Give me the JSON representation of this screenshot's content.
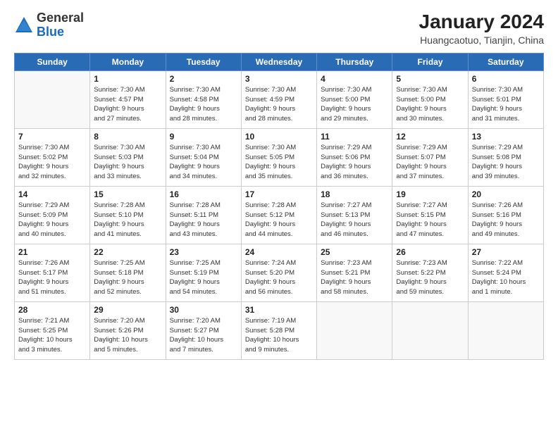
{
  "logo": {
    "general": "General",
    "blue": "Blue"
  },
  "title": "January 2024",
  "location": "Huangcaotuo, Tianjin, China",
  "weekdays": [
    "Sunday",
    "Monday",
    "Tuesday",
    "Wednesday",
    "Thursday",
    "Friday",
    "Saturday"
  ],
  "weeks": [
    [
      {
        "day": "",
        "info": ""
      },
      {
        "day": "1",
        "info": "Sunrise: 7:30 AM\nSunset: 4:57 PM\nDaylight: 9 hours\nand 27 minutes."
      },
      {
        "day": "2",
        "info": "Sunrise: 7:30 AM\nSunset: 4:58 PM\nDaylight: 9 hours\nand 28 minutes."
      },
      {
        "day": "3",
        "info": "Sunrise: 7:30 AM\nSunset: 4:59 PM\nDaylight: 9 hours\nand 28 minutes."
      },
      {
        "day": "4",
        "info": "Sunrise: 7:30 AM\nSunset: 5:00 PM\nDaylight: 9 hours\nand 29 minutes."
      },
      {
        "day": "5",
        "info": "Sunrise: 7:30 AM\nSunset: 5:00 PM\nDaylight: 9 hours\nand 30 minutes."
      },
      {
        "day": "6",
        "info": "Sunrise: 7:30 AM\nSunset: 5:01 PM\nDaylight: 9 hours\nand 31 minutes."
      }
    ],
    [
      {
        "day": "7",
        "info": "Sunrise: 7:30 AM\nSunset: 5:02 PM\nDaylight: 9 hours\nand 32 minutes."
      },
      {
        "day": "8",
        "info": "Sunrise: 7:30 AM\nSunset: 5:03 PM\nDaylight: 9 hours\nand 33 minutes."
      },
      {
        "day": "9",
        "info": "Sunrise: 7:30 AM\nSunset: 5:04 PM\nDaylight: 9 hours\nand 34 minutes."
      },
      {
        "day": "10",
        "info": "Sunrise: 7:30 AM\nSunset: 5:05 PM\nDaylight: 9 hours\nand 35 minutes."
      },
      {
        "day": "11",
        "info": "Sunrise: 7:29 AM\nSunset: 5:06 PM\nDaylight: 9 hours\nand 36 minutes."
      },
      {
        "day": "12",
        "info": "Sunrise: 7:29 AM\nSunset: 5:07 PM\nDaylight: 9 hours\nand 37 minutes."
      },
      {
        "day": "13",
        "info": "Sunrise: 7:29 AM\nSunset: 5:08 PM\nDaylight: 9 hours\nand 39 minutes."
      }
    ],
    [
      {
        "day": "14",
        "info": "Sunrise: 7:29 AM\nSunset: 5:09 PM\nDaylight: 9 hours\nand 40 minutes."
      },
      {
        "day": "15",
        "info": "Sunrise: 7:28 AM\nSunset: 5:10 PM\nDaylight: 9 hours\nand 41 minutes."
      },
      {
        "day": "16",
        "info": "Sunrise: 7:28 AM\nSunset: 5:11 PM\nDaylight: 9 hours\nand 43 minutes."
      },
      {
        "day": "17",
        "info": "Sunrise: 7:28 AM\nSunset: 5:12 PM\nDaylight: 9 hours\nand 44 minutes."
      },
      {
        "day": "18",
        "info": "Sunrise: 7:27 AM\nSunset: 5:13 PM\nDaylight: 9 hours\nand 46 minutes."
      },
      {
        "day": "19",
        "info": "Sunrise: 7:27 AM\nSunset: 5:15 PM\nDaylight: 9 hours\nand 47 minutes."
      },
      {
        "day": "20",
        "info": "Sunrise: 7:26 AM\nSunset: 5:16 PM\nDaylight: 9 hours\nand 49 minutes."
      }
    ],
    [
      {
        "day": "21",
        "info": "Sunrise: 7:26 AM\nSunset: 5:17 PM\nDaylight: 9 hours\nand 51 minutes."
      },
      {
        "day": "22",
        "info": "Sunrise: 7:25 AM\nSunset: 5:18 PM\nDaylight: 9 hours\nand 52 minutes."
      },
      {
        "day": "23",
        "info": "Sunrise: 7:25 AM\nSunset: 5:19 PM\nDaylight: 9 hours\nand 54 minutes."
      },
      {
        "day": "24",
        "info": "Sunrise: 7:24 AM\nSunset: 5:20 PM\nDaylight: 9 hours\nand 56 minutes."
      },
      {
        "day": "25",
        "info": "Sunrise: 7:23 AM\nSunset: 5:21 PM\nDaylight: 9 hours\nand 58 minutes."
      },
      {
        "day": "26",
        "info": "Sunrise: 7:23 AM\nSunset: 5:22 PM\nDaylight: 9 hours\nand 59 minutes."
      },
      {
        "day": "27",
        "info": "Sunrise: 7:22 AM\nSunset: 5:24 PM\nDaylight: 10 hours\nand 1 minute."
      }
    ],
    [
      {
        "day": "28",
        "info": "Sunrise: 7:21 AM\nSunset: 5:25 PM\nDaylight: 10 hours\nand 3 minutes."
      },
      {
        "day": "29",
        "info": "Sunrise: 7:20 AM\nSunset: 5:26 PM\nDaylight: 10 hours\nand 5 minutes."
      },
      {
        "day": "30",
        "info": "Sunrise: 7:20 AM\nSunset: 5:27 PM\nDaylight: 10 hours\nand 7 minutes."
      },
      {
        "day": "31",
        "info": "Sunrise: 7:19 AM\nSunset: 5:28 PM\nDaylight: 10 hours\nand 9 minutes."
      },
      {
        "day": "",
        "info": ""
      },
      {
        "day": "",
        "info": ""
      },
      {
        "day": "",
        "info": ""
      }
    ]
  ]
}
